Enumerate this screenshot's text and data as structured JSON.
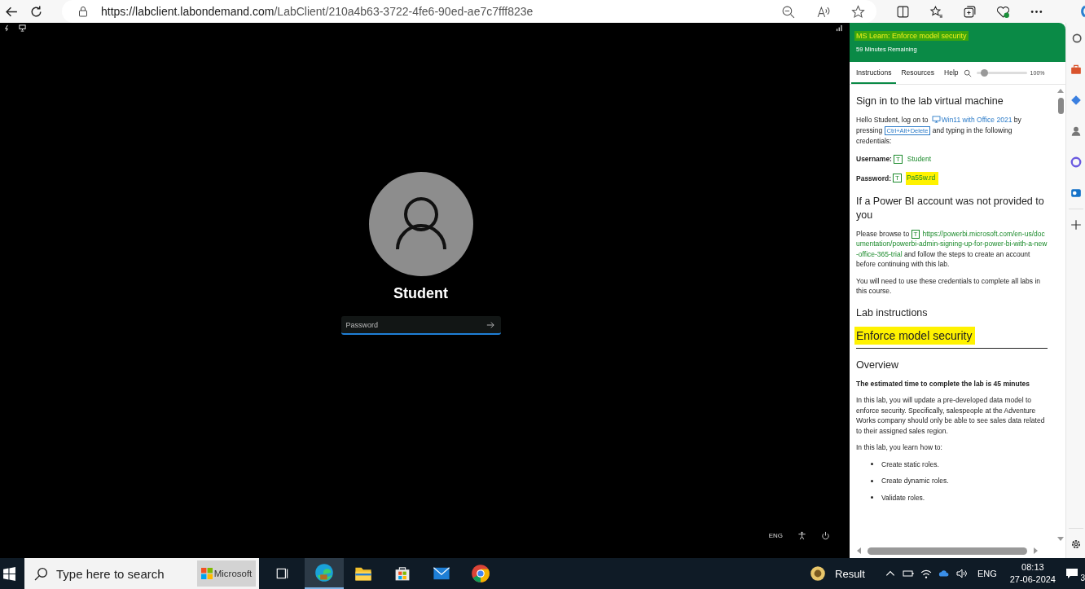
{
  "browser": {
    "url_host": "https://labclient.labondemand.com",
    "url_path": "/LabClient/210a4b63-3722-4fe6-90ed-ae7c7fff823e"
  },
  "vm": {
    "user_name": "Student",
    "password_placeholder": "Password",
    "language": "ENG"
  },
  "lab_panel": {
    "title": "MS Learn: Enforce model security",
    "title_highlighted": true,
    "time_remaining": "59 Minutes Remaining",
    "tabs": [
      {
        "label": "Instructions",
        "selected": true
      },
      {
        "label": "Resources",
        "selected": false
      },
      {
        "label": "Help",
        "selected": false
      }
    ],
    "zoom": {
      "level": 0.15,
      "reading": "100%"
    },
    "content": [
      {
        "kind": "heading",
        "text": "Sign in to the lab virtual machine",
        "highlighted": false
      },
      {
        "kind": "paragraph",
        "parts": [
          {
            "kind": "text",
            "text": "Hello Student, log on to "
          },
          {
            "kind": "vm",
            "text": "Win11 with Office 2021"
          },
          {
            "kind": "text",
            "text": " by pressing "
          },
          {
            "kind": "key",
            "text": "Ctrl+Alt+Delete"
          },
          {
            "kind": "text",
            "text": " and typing in the following credentials:"
          }
        ]
      },
      {
        "kind": "credential",
        "label": "Username:",
        "button": "T",
        "value": "Student",
        "highlighted": false
      },
      {
        "kind": "credential",
        "label": "Password:",
        "button": "T",
        "value": "Pa55w.rd",
        "highlighted": true
      },
      {
        "kind": "heading",
        "text": "If a Power BI account was not provided to you",
        "highlighted": false
      },
      {
        "kind": "paragraph",
        "parts": [
          {
            "kind": "text",
            "text": "Please browse to "
          },
          {
            "kind": "typebutton",
            "text": "T"
          },
          {
            "kind": "link",
            "text": "https://powerbi.microsoft.com/en-us/documentation/powerbi-admin-signing-up-for-power-bi-with-a-new-office-365-trial"
          },
          {
            "kind": "text",
            "text": " and follow the steps to create an account before continuing with this lab."
          }
        ]
      },
      {
        "kind": "paragraph",
        "parts": [
          {
            "kind": "text",
            "text": "You will need to use these credentials to complete all labs in this course."
          }
        ]
      },
      {
        "kind": "heading",
        "text": "Lab instructions",
        "highlighted": false
      },
      {
        "kind": "title",
        "text": "Enforce model security",
        "highlighted": true
      },
      {
        "kind": "heading",
        "text": "Overview",
        "highlighted": false
      },
      {
        "kind": "bold",
        "text": "The estimated time to complete the lab is 45 minutes"
      },
      {
        "kind": "paragraph",
        "parts": [
          {
            "kind": "text",
            "text": "In this lab, you will update a pre-developed data model to enforce security. Specifically, salespeople at the Adventure Works company should only be able to see sales data related to their assigned sales region."
          }
        ]
      },
      {
        "kind": "paragraph",
        "parts": [
          {
            "kind": "text",
            "text": "In this lab, you learn how to:"
          }
        ]
      },
      {
        "kind": "bullets",
        "items": [
          "Create static roles.",
          "Create dynamic roles.",
          "Validate roles."
        ]
      }
    ]
  },
  "taskbar": {
    "search_placeholder": "Type here to search",
    "widget": "Microsoft",
    "weather": "Result",
    "language": "ENG",
    "time": "08:13",
    "date": "27-06-2024",
    "notifications": "3",
    "apps": [
      {
        "kind": "edge",
        "selected": true
      },
      {
        "kind": "files",
        "selected": false
      },
      {
        "kind": "store",
        "selected": false
      },
      {
        "kind": "mail",
        "selected": false
      },
      {
        "kind": "chrome",
        "selected": false
      }
    ]
  }
}
